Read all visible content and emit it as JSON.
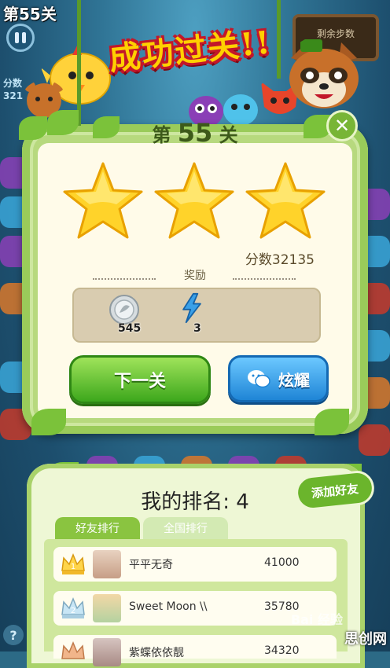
{
  "hud": {
    "level_text": "第55关",
    "score_label": "分数",
    "score_value": "321",
    "moves_label": "剩余步数"
  },
  "banner": {
    "text": "成功过关!!"
  },
  "result_panel": {
    "level_prefix": "第",
    "level_number": "55",
    "level_suffix": "关",
    "stars_earned": 3,
    "stars_total": 3,
    "score_text": "分数32135",
    "reward_title": "奖励",
    "rewards": [
      {
        "icon": "silver-coin-icon",
        "count": "545"
      },
      {
        "icon": "lightning-icon",
        "count": "3"
      }
    ],
    "next_button": "下一关",
    "show_off_button": "炫耀",
    "close_symbol": "✕"
  },
  "ranking": {
    "title": "我的排名: 4",
    "add_friend_button": "添加好友",
    "tabs": [
      {
        "label": "好友排行",
        "active": true
      },
      {
        "label": "全国排行",
        "active": false
      }
    ],
    "rows": [
      {
        "rank": 1,
        "medal": "gold-crown-icon",
        "name": "平平无奇",
        "score": "41000"
      },
      {
        "rank": 2,
        "medal": "silver-crown-icon",
        "name": "Sweet Moon \\\\",
        "score": "35780"
      },
      {
        "rank": 3,
        "medal": "bronze-crown-icon",
        "name": "紫蝶依依靓",
        "score": "34320"
      }
    ]
  },
  "help_symbol": "?",
  "watermark": {
    "baidu": "Bai 经验",
    "site": "思创网"
  },
  "colors": {
    "panel_green": "#9acb5a",
    "next_button": "#3da71c",
    "show_button": "#1f85d6",
    "title_yellow": "#ffd000",
    "title_outline": "#c2172a"
  }
}
